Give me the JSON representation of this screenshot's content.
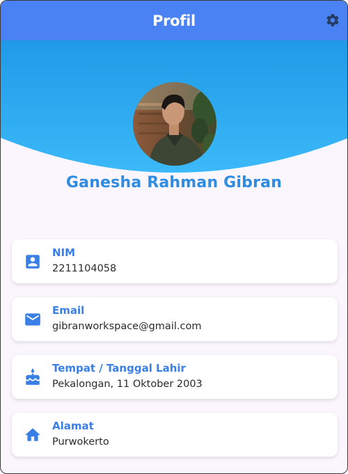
{
  "appbar": {
    "title": "Profil",
    "settings_icon": "gear-icon"
  },
  "profile": {
    "name": "Ganesha Rahman Gibran",
    "avatar": "profile-photo"
  },
  "info_items": [
    {
      "label": "NIM",
      "value": "2211104058",
      "icon": "badge-icon"
    },
    {
      "label": "Email",
      "value": "gibranworkspace@gmail.com",
      "icon": "email-icon"
    },
    {
      "label": "Tempat / Tanggal Lahir",
      "value": "Pekalongan, 11 Oktober 2003",
      "icon": "cake-icon"
    },
    {
      "label": "Alamat",
      "value": "Purwokerto",
      "icon": "home-icon"
    }
  ],
  "colors": {
    "appbar": "#4a82f3",
    "header_gradient_top": "#1f9ae8",
    "header_gradient_bottom": "#3bb9f8",
    "accent": "#3a7fe6",
    "name_color": "#2f8ce0",
    "background": "#fbf5fd"
  }
}
